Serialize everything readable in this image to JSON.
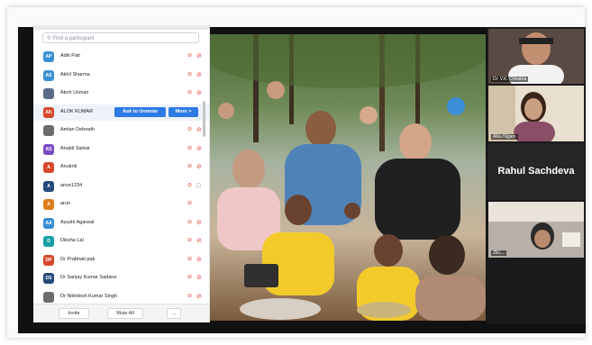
{
  "search": {
    "placeholder": "Find a participant"
  },
  "participants": [
    {
      "initials": "AP",
      "name": "Aditi Pati",
      "color": "#3a8fd4",
      "cam_off": true
    },
    {
      "initials": "AS",
      "name": "Akhil Sharma",
      "color": "#3a8fd4",
      "cam_off": true
    },
    {
      "initials": "",
      "name": "Akoh Usman",
      "color": "#5b6b86",
      "cam_off": true
    },
    {
      "initials": "AK",
      "name": "ALOK KUMAR",
      "color": "#d5492a",
      "selected": true
    },
    {
      "initials": "",
      "name": "Amlan Debnath",
      "color": "#6b6b6b",
      "cam_off": true
    },
    {
      "initials": "AS",
      "name": "Anabil Sarkar",
      "color": "#7a4cc2",
      "cam_off": true
    },
    {
      "initials": "A",
      "name": "Anukriti",
      "color": "#d5492a",
      "cam_off": true
    },
    {
      "initials": "A",
      "name": "anve1234",
      "color": "#234a7a",
      "cam_off": false
    },
    {
      "initials": "A",
      "name": "arun",
      "color": "#e07d1c",
      "cam_off": null
    },
    {
      "initials": "AA",
      "name": "Ayushi Agarwal",
      "color": "#3a8fd4",
      "cam_off": true
    },
    {
      "initials": "D",
      "name": "Diksha Lal",
      "color": "#14a0a6",
      "cam_off": true
    },
    {
      "initials": "DP",
      "name": "Dr Prabhati pati",
      "color": "#d5492a",
      "cam_off": true
    },
    {
      "initials": "DS",
      "name": "Dr Sanjay Kumar Sadana",
      "color": "#234a7a",
      "cam_off": true
    },
    {
      "initials": "",
      "name": "Dr Nikhilesh Kumar Singh",
      "color": "#6b6b6b",
      "cam_off": true
    }
  ],
  "selected_actions": {
    "ask_unmute": "Ask to Unmute",
    "more": "More >"
  },
  "footer": {
    "invite": "Invite",
    "mute_all": "Mute All",
    "more": "..."
  },
  "tiles": [
    {
      "name": "Dr. V.K. Chhabra"
    },
    {
      "name": "Alka Nigam"
    },
    {
      "name": "Rahul Sachdeva",
      "name_only": true
    },
    {
      "name": "ZEL..."
    }
  ],
  "colors": {
    "accent": "#2d7be5",
    "muted_red": "#e0433b"
  }
}
